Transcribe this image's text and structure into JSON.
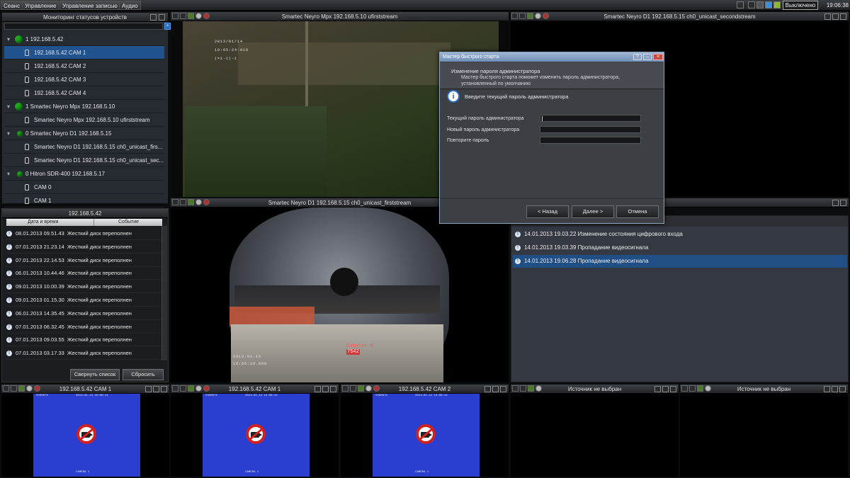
{
  "menubar": {
    "items": [
      "Сеанс",
      "Управление",
      "Управление записью",
      "Аудио"
    ],
    "status": "Выключено",
    "clock": "19:06:38"
  },
  "tree": {
    "title": "Мониторинг статусов устройств",
    "rows": [
      {
        "label": "1   192.168.5.42",
        "kind": "device"
      },
      {
        "label": "192.168.5.42 CAM 1",
        "kind": "camera"
      },
      {
        "label": "192.168.5.42 CAM 2",
        "kind": "camera"
      },
      {
        "label": "192.168.5.42 CAM 3",
        "kind": "camera"
      },
      {
        "label": "192.168.5.42 CAM 4",
        "kind": "camera"
      },
      {
        "label": "1  Smartec Neyro Mpx 192.168.5.10",
        "kind": "device"
      },
      {
        "label": "Smartec Neyro Mpx 192.168.5.10 ufirststream",
        "kind": "camera"
      },
      {
        "label": "0  Smartec Neyro D1 192.168.5.15",
        "kind": "device"
      },
      {
        "label": "Smartec Neyro D1 192.168.5.15 ch0_unicast_firs...",
        "kind": "camera"
      },
      {
        "label": "Smartec Neyro D1 192.168.5.15 ch0_unicast_sec...",
        "kind": "camera"
      },
      {
        "label": "0  Hitron SDR-400 192.168.5.17",
        "kind": "device"
      },
      {
        "label": "CAM 0",
        "kind": "camera"
      },
      {
        "label": "CAM 1",
        "kind": "camera"
      }
    ]
  },
  "events_left": {
    "title": "192.168.5.42",
    "col_date": "Дата и время",
    "col_event": "Событие",
    "rows": [
      {
        "time": "08.01.2013  09.51.43",
        "event": "Жесткий диск переполнен"
      },
      {
        "time": "07.01.2013  21.23.14",
        "event": "Жесткий диск переполнен"
      },
      {
        "time": "07.01.2013  22.14.53",
        "event": "Жесткий диск переполнен"
      },
      {
        "time": "06.01.2013  10.44.46",
        "event": "Жесткий диск переполнен"
      },
      {
        "time": "09.01.2013  10.00.39",
        "event": "Жесткий диск переполнен"
      },
      {
        "time": "09.01.2013  01.15.30",
        "event": "Жесткий диск переполнен"
      },
      {
        "time": "06.01.2013  14.35.45",
        "event": "Жесткий диск переполнен"
      },
      {
        "time": "07.01.2013  06.32.45",
        "event": "Жесткий диск переполнен"
      },
      {
        "time": "07.01.2013  09.03.55",
        "event": "Жесткий диск переполнен"
      },
      {
        "time": "07.01.2013  03.17.33",
        "event": "Жесткий диск переполнен"
      }
    ],
    "collapse_btn": "Свернуть список",
    "reset_btn": "Сбросить"
  },
  "views": {
    "top_left": "Smartec Neyro Mpx 192.168.5.10 ufirststream",
    "top_right": "Smartec Neyro D1 192.168.5.15 ch0_unicast_secondstream",
    "middle": "Smartec Neyro D1 192.168.5.15 ch0_unicast_firststream",
    "bottom": [
      "192.168.5.42 CAM 1",
      "192.168.5.42 CAM 1",
      "192.168.5.42 CAM 2",
      "Источник не выбран",
      "Источник не выбран"
    ]
  },
  "overlay": {
    "cam1_date": "2013/01/14",
    "cam1_time": "19:05:24:016",
    "cam1_code": "(=1-1)-1",
    "cam2_counter": "Counter 0",
    "cam2_count": "7542",
    "cam2_date": "2013-01-15",
    "cam2_time": "19:05:28.000",
    "blue_id": "CH30074",
    "blue_ts": "2013-01-14 19:06:14",
    "blue_foot": "CAMERA 1"
  },
  "dialog": {
    "title": "Мастер быстрого старта",
    "heading": "Изменение пароля администратора",
    "description": "Мастер быстрого старта поможет изменить пароль администратора, установленный по умолчанию",
    "info": "Введите текущий пароль администратора",
    "label_current": "Текущий пароль администратора",
    "label_new": "Новый пароль администратора",
    "label_repeat": "Повторите пароль",
    "back": "< Назад",
    "next": "Далее >",
    "cancel": "Отмена"
  },
  "events_right": {
    "rows": [
      {
        "text": "14.01.2013  19.03.22  Изменение состояния цифрового входа"
      },
      {
        "text": "14.01.2013  19.03.39  Пропадание видеосигнала"
      },
      {
        "text": "14.01.2013  19.06.28  Пропадание видеосигнала"
      }
    ]
  }
}
